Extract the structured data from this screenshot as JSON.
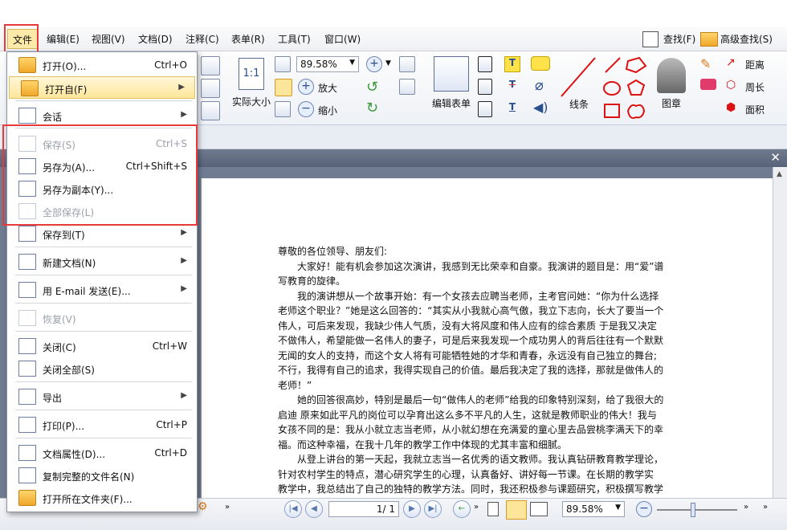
{
  "menubar": {
    "items": [
      "文件",
      "编辑(E)",
      "视图(V)",
      "文档(D)",
      "注释(C)",
      "表单(R)",
      "工具(T)",
      "窗口(W)"
    ],
    "find": "查找(F)",
    "advanced_find": "高级查找(S)"
  },
  "ribbon": {
    "zoom_value": "89.58%",
    "fit_label": "1:1",
    "actual_size": "实际大小",
    "zoom_in": "放大",
    "zoom_out": "缩小",
    "edit_form": "编辑表单",
    "lines": "线条",
    "stamp": "图章",
    "distance": "距离",
    "perimeter": "周长",
    "area": "面积"
  },
  "dropdown": {
    "items": [
      {
        "label": "打开(O)...",
        "shortcut": "Ctrl+O",
        "arrow": "",
        "disabled": false,
        "icon": "open-folder-icon"
      },
      {
        "label": "打开自(F)",
        "shortcut": "",
        "arrow": "▶",
        "disabled": false,
        "icon": "open-from-icon"
      },
      {
        "label": "会话",
        "shortcut": "",
        "arrow": "▶",
        "disabled": false,
        "icon": "session-icon"
      },
      {
        "label": "保存(S)",
        "shortcut": "Ctrl+S",
        "arrow": "",
        "disabled": true,
        "icon": "save-icon"
      },
      {
        "label": "另存为(A)...",
        "shortcut": "Ctrl+Shift+S",
        "arrow": "",
        "disabled": false,
        "icon": "save-as-icon"
      },
      {
        "label": "另存为副本(Y)...",
        "shortcut": "",
        "arrow": "",
        "disabled": false,
        "icon": "save-copy-icon"
      },
      {
        "label": "全部保存(L)",
        "shortcut": "",
        "arrow": "",
        "disabled": true,
        "icon": "save-all-icon"
      },
      {
        "label": "保存到(T)",
        "shortcut": "",
        "arrow": "▶",
        "disabled": false,
        "icon": "save-to-icon"
      },
      {
        "label": "新建文档(N)",
        "shortcut": "",
        "arrow": "▶",
        "disabled": false,
        "icon": "new-document-icon"
      },
      {
        "label": "用 E-mail 发送(E)...",
        "shortcut": "",
        "arrow": "▶",
        "disabled": false,
        "icon": "email-icon"
      },
      {
        "label": "恢复(V)",
        "shortcut": "",
        "arrow": "",
        "disabled": true,
        "icon": "revert-icon"
      },
      {
        "label": "关闭(C)",
        "shortcut": "Ctrl+W",
        "arrow": "",
        "disabled": false,
        "icon": "close-doc-icon"
      },
      {
        "label": "关闭全部(S)",
        "shortcut": "",
        "arrow": "",
        "disabled": false,
        "icon": "close-all-icon"
      },
      {
        "label": "导出",
        "shortcut": "",
        "arrow": "▶",
        "disabled": false,
        "icon": "export-icon"
      },
      {
        "label": "打印(P)...",
        "shortcut": "Ctrl+P",
        "arrow": "",
        "disabled": false,
        "icon": "printer-icon"
      },
      {
        "label": "文档属性(D)...",
        "shortcut": "Ctrl+D",
        "arrow": "",
        "disabled": false,
        "icon": "properties-icon"
      },
      {
        "label": "复制完整的文件名(N)",
        "shortcut": "",
        "arrow": "",
        "disabled": false,
        "icon": "copy-filename-icon"
      },
      {
        "label": "打开所在文件夹(F)...",
        "shortcut": "",
        "arrow": "",
        "disabled": false,
        "icon": "open-containing-folder-icon"
      }
    ]
  },
  "document": {
    "lines": [
      "尊敬的各位领导、朋友们:",
      "　　大家好！能有机会参加这次演讲，我感到无比荣幸和自豪。我演讲的题目是：用“爱”谱",
      "写教育的旋律。",
      "　　我的演讲想从一个故事开始：有一个女孩去应聘当老师，主考官问她：“你为什么选择",
      "老师这个职业？”她是这么回答的：“其实从小我就心高气傲，我立下志向，长大了要当一个",
      "伟人，可后来发现，我缺少伟人气质，没有大将风度和伟人应有的综合素质 于是我又决定",
      "不做伟人，希望能做一名伟人的妻子，可是后来我发现一个成功男人的背后往往有一个默默",
      "无闻的女人的支持，而这个女人将有可能牺牲她的才华和青春，永远没有自己独立的舞台;",
      "不行，我得有自己的追求，我得实现自己的价值。最后我决定了我的选择，那就是做伟人的",
      "老师！”",
      "　　她的回答很高妙，特别是最后一句“做伟人的老师”给我的印象特别深刻，给了我很大的",
      "启迪 原来如此平凡的岗位可以孕育出这么多不平凡的人生，这就是教师职业的伟大！我与",
      "女孩不同的是：我从小就立志当老师，从小就幻想在充满爱的童心里去品尝桃李满天下的幸",
      "福。而这种幸福，在我十几年的教学工作中体现的尤其丰富和细腻。",
      "　　从登上讲台的第一天起，我就立志当一名优秀的语文教师。我认真钻研教育教学理论，",
      "针对农村学生的特点，潜心研究学生的心理，认真备好、讲好每一节课。在长期的教学实",
      "教学中，我总结出了自己的独特的教学方法。同时，我还积极参与课题研究，积极撰写教学"
    ]
  },
  "statusbar": {
    "page_input": "1",
    "page_total": "/ 1",
    "zoom_value": "89.58%"
  },
  "colors": {
    "highlight": "#fde69a",
    "red_box": "#e83a3a",
    "accent": "#2a4f8f"
  }
}
